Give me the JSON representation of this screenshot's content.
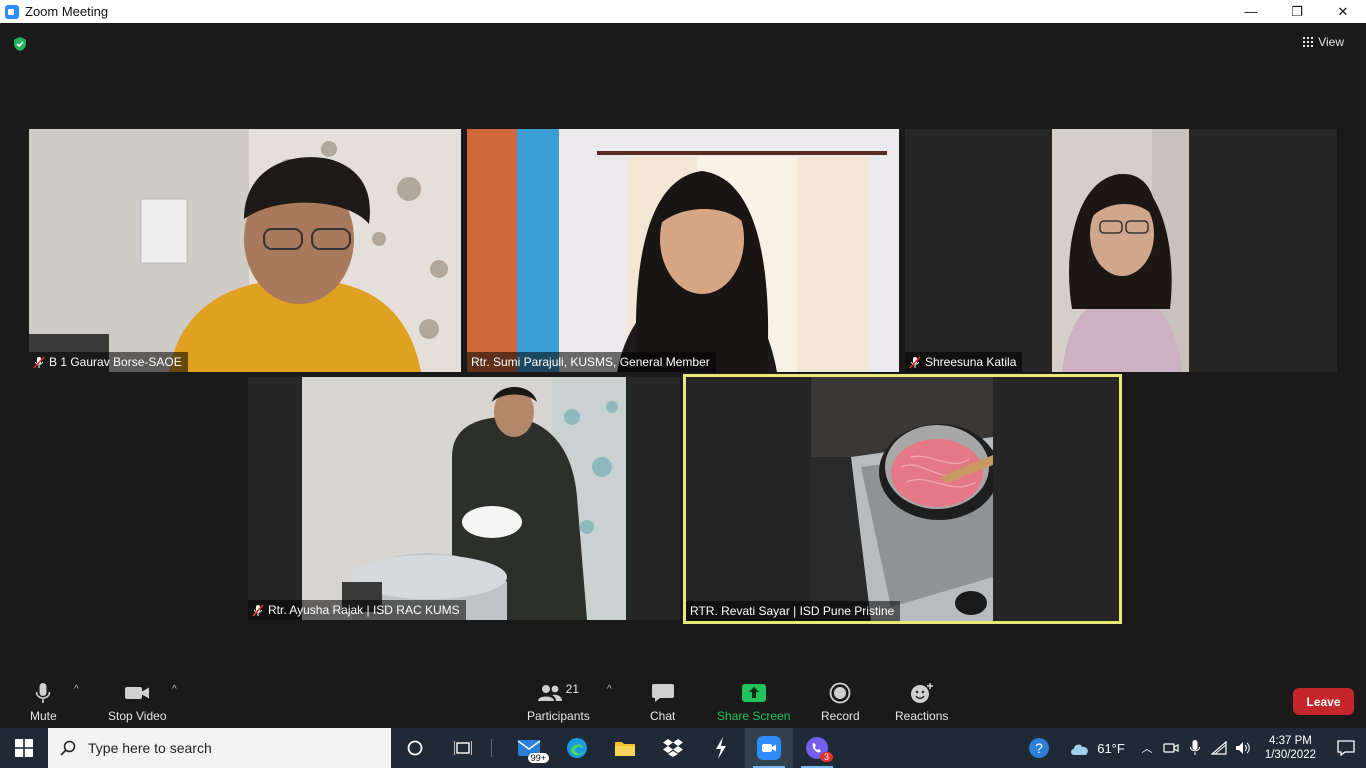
{
  "window": {
    "title": "Zoom Meeting",
    "minimize": "—",
    "restore": "❐",
    "close": "✕"
  },
  "view": {
    "label": "View"
  },
  "participants_tiles": [
    {
      "name": "B 1 Gaurav Borse-SAOE",
      "muted": true
    },
    {
      "name": "Rtr. Sumi Parajuli, KUSMS, General Member",
      "muted": false
    },
    {
      "name": "Shreesuna Katila",
      "muted": true
    },
    {
      "name": "Rtr. Ayusha Rajak | ISD RAC KUMS",
      "muted": true
    },
    {
      "name": "RTR. Revati Sayar | ISD Pune Pristine",
      "muted": false,
      "active_speaker": true
    }
  ],
  "toolbar": {
    "mute": "Mute",
    "stop_video": "Stop Video",
    "participants": "Participants",
    "participants_count": "21",
    "chat": "Chat",
    "share_screen": "Share Screen",
    "record": "Record",
    "reactions": "Reactions",
    "leave": "Leave"
  },
  "taskbar": {
    "search_placeholder": "Type here to search",
    "mail_badge": "99+",
    "viber_badge": "3",
    "weather": "61°F",
    "time": "4:37 PM",
    "date": "1/30/2022"
  },
  "colors": {
    "accent": "#2d8cff",
    "share_green": "#22c35b",
    "leave_red": "#c4262b",
    "active_speaker": "#e7e77a"
  }
}
